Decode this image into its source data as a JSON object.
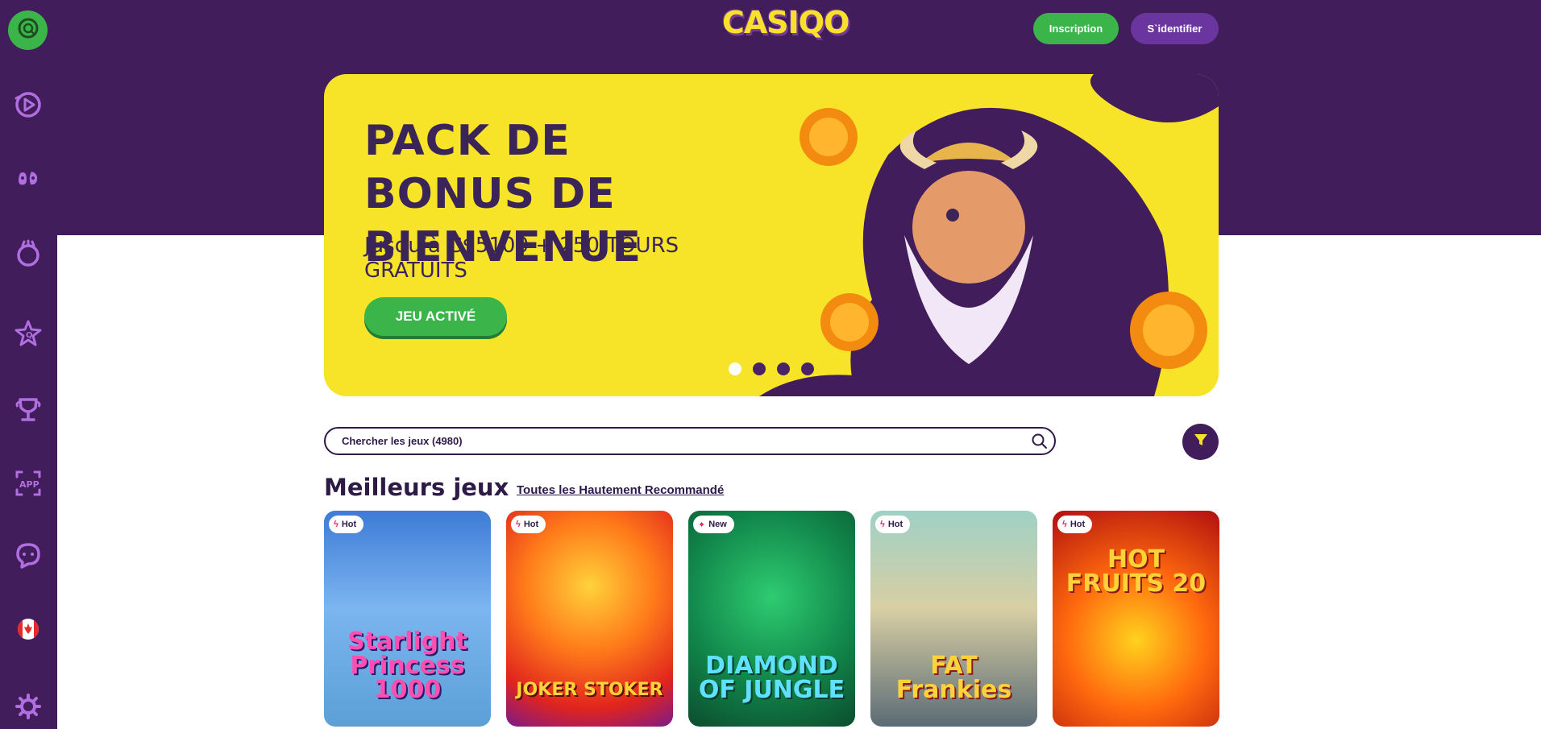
{
  "brand": {
    "logo_text": "CASIQO"
  },
  "header": {
    "register_label": "Inscription",
    "login_label": "S`identifier"
  },
  "sidebar": {
    "items": [
      {
        "name": "profile-icon"
      },
      {
        "name": "play-icon"
      },
      {
        "name": "live-icon"
      },
      {
        "name": "slot-icon"
      },
      {
        "name": "star-icon"
      },
      {
        "name": "trophy-icon"
      },
      {
        "name": "app-icon"
      },
      {
        "name": "chat-icon"
      },
      {
        "name": "canada-flag-icon"
      },
      {
        "name": "gear-icon"
      }
    ]
  },
  "banner": {
    "title": "PACK DE BONUS DE BIENVENUE",
    "subtitle": "Jusqu’à C$5100 + 250 TOURS GRATUITS",
    "cta_label": "JEU ACTIVÉ",
    "slides": 4,
    "active_slide": 1
  },
  "search": {
    "placeholder": "Chercher les jeux (4980)"
  },
  "section": {
    "title": "Meilleurs jeux",
    "link_label": "Toutes les Hautement Recommandé"
  },
  "games": [
    {
      "badge": "Hot",
      "title": "Starlight Princess 1000"
    },
    {
      "badge": "Hot",
      "title": "JOKER STOKER"
    },
    {
      "badge": "New",
      "title": "DIAMOND OF JUNGLE"
    },
    {
      "badge": "Hot",
      "title": "FAT Frankies"
    },
    {
      "badge": "Hot",
      "title": "HOT FRUITS 20"
    }
  ],
  "colors": {
    "primary": "#421d5c",
    "accent_green": "#3bb54a",
    "banner_yellow": "#f7e428",
    "text_dark": "#2e1a47",
    "icon_purple": "#b06ee0"
  }
}
